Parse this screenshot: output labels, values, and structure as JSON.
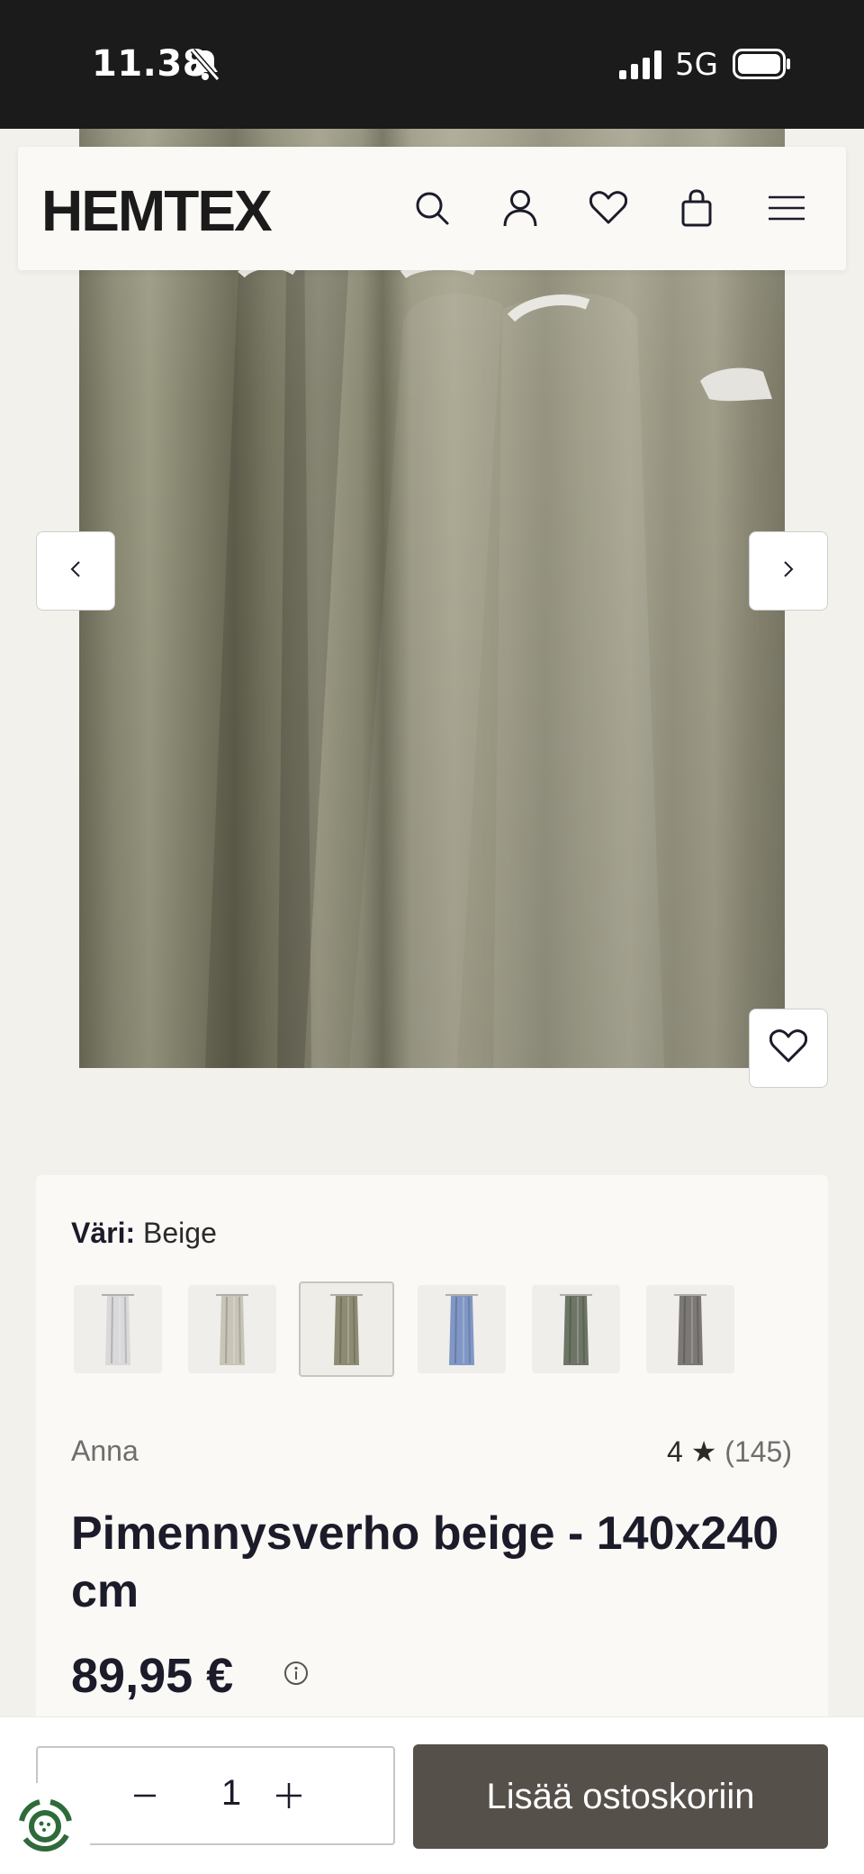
{
  "status_bar": {
    "time": "11.38",
    "network": "5G",
    "icons": [
      "bell-slash-icon",
      "signal-icon",
      "battery-icon"
    ]
  },
  "header": {
    "logo": "HEMTEX",
    "icons": [
      "search-icon",
      "account-icon",
      "heart-icon",
      "bag-icon",
      "menu-icon"
    ]
  },
  "gallery": {
    "prev_icon": "chevron-left-icon",
    "next_icon": "chevron-right-icon",
    "wishlist_icon": "heart-icon"
  },
  "product": {
    "color_label": "Väri:",
    "color_value": "Beige",
    "swatches": [
      {
        "name": "white",
        "color": "#d9d9db"
      },
      {
        "name": "light-beige",
        "color": "#c8c5b8"
      },
      {
        "name": "beige",
        "color": "#8e8b73",
        "selected": true
      },
      {
        "name": "blue",
        "color": "#8097c6"
      },
      {
        "name": "green",
        "color": "#6d7565"
      },
      {
        "name": "grey",
        "color": "#7b7876"
      }
    ],
    "brand": "Anna",
    "rating": "4 ★",
    "review_count": "(145)",
    "title": "Pimennysverho beige - 140x240 cm",
    "price": "89,95 €"
  },
  "cart": {
    "quantity": "1",
    "add_label": "Lisää ostoskoriin"
  },
  "colors": {
    "status_bg": "#1b1b1b",
    "page_bg": "#f3f1ec",
    "card_bg": "#faf9f5",
    "button_bg": "#56504b"
  }
}
